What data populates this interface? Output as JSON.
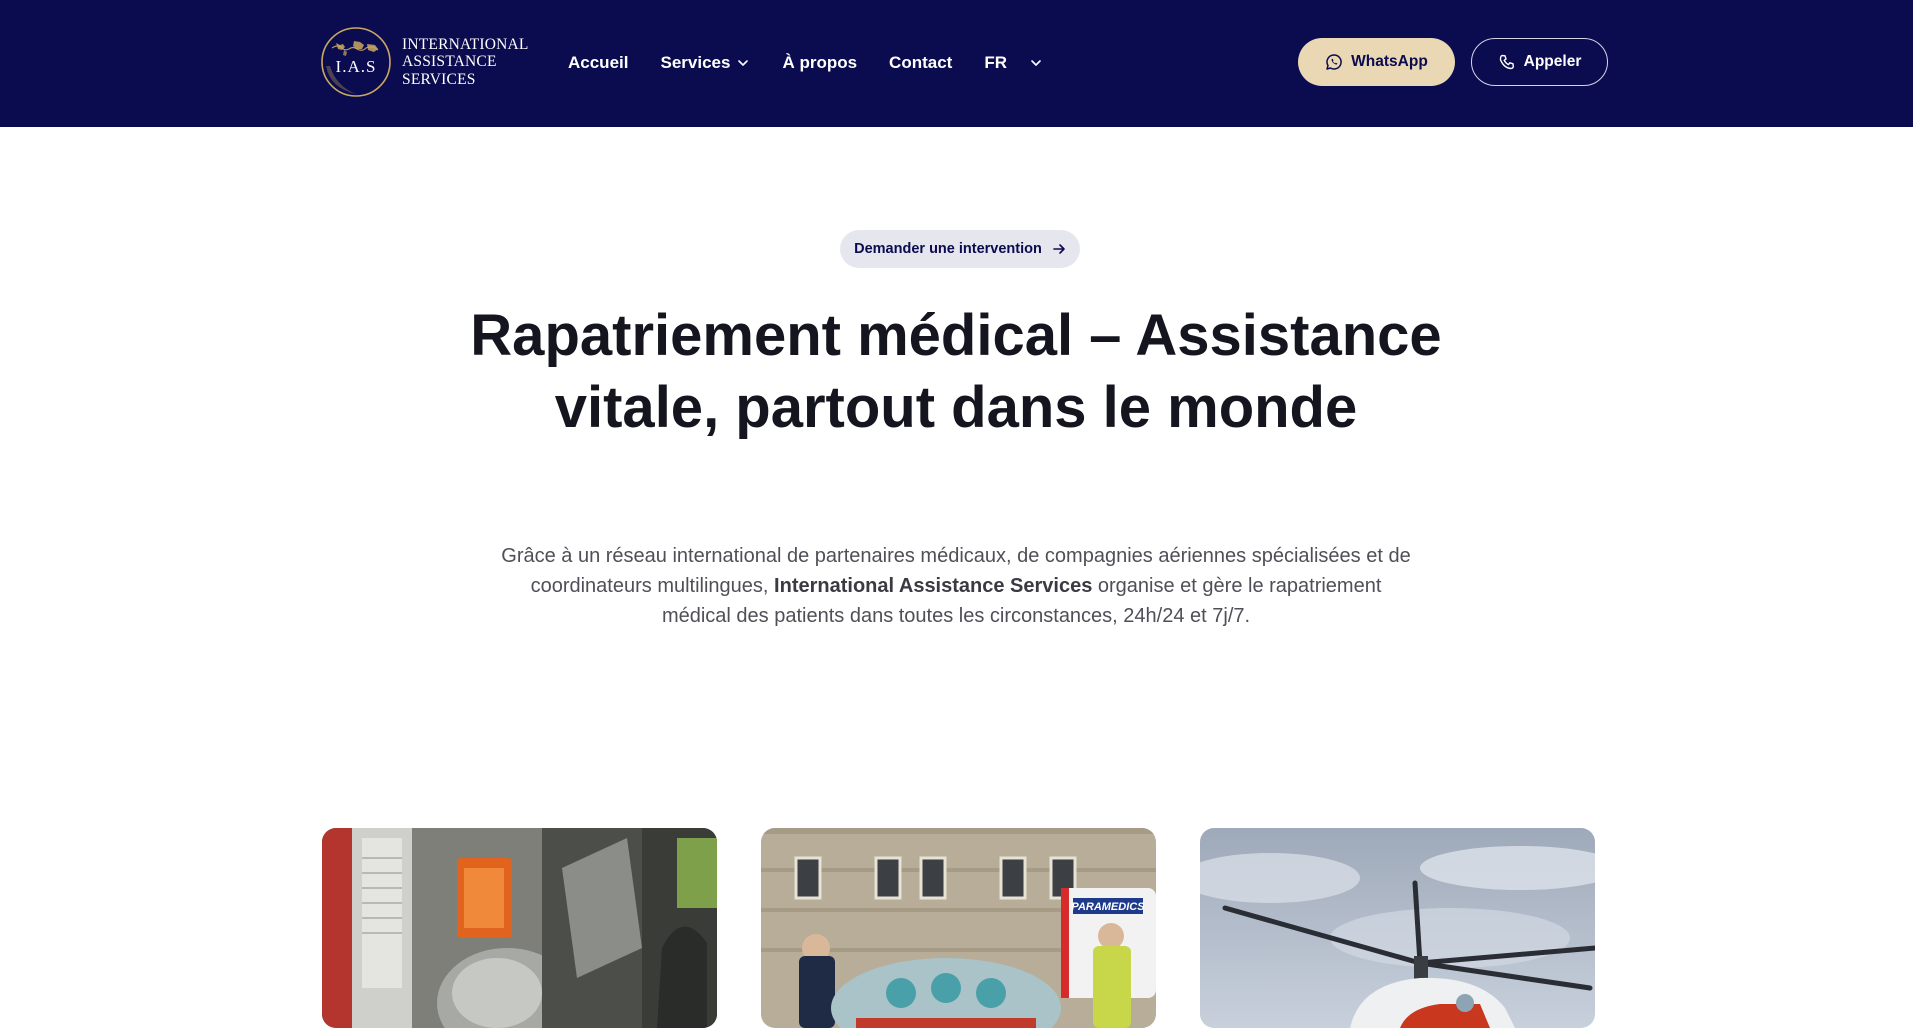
{
  "header": {
    "logo": {
      "monogram": "I.A.S",
      "lines": [
        "INTERNATIONAL",
        "ASSISTANCE",
        "SERVICES"
      ]
    },
    "nav": [
      {
        "label": "Accueil",
        "has_dropdown": false
      },
      {
        "label": "Services",
        "has_dropdown": true
      },
      {
        "label": "À propos",
        "has_dropdown": false
      },
      {
        "label": "Contact",
        "has_dropdown": false
      }
    ],
    "language": {
      "selected": "FR"
    },
    "whatsapp_label": "WhatsApp",
    "call_label": "Appeler"
  },
  "hero": {
    "badge_label": "Demander une intervention",
    "title": "Rapatriement médical – Assistance vitale, partout dans le monde",
    "description_before": "Grâce à un réseau international de partenaires médicaux, de compagnies aériennes spécialisées et de coordinateurs multilingues, ",
    "description_bold": "International Assistance Services",
    "description_after": " organise et gère le rapatriement médical des patients dans toutes les circonstances, 24h/24 et 7j/7."
  },
  "cards": [
    {
      "image": "ambulance-interior-photo"
    },
    {
      "image": "paramedics-stretcher-photo"
    },
    {
      "image": "medical-helicopter-photo"
    }
  ],
  "colors": {
    "header_bg": "#0b0b4f",
    "accent_gold": "#ead8b4",
    "pill_bg": "#e6e6ee",
    "text_dark": "#15151f",
    "text_muted": "#4f4f57"
  },
  "icons": {
    "whatsapp": "whatsapp-icon",
    "call": "phone-icon",
    "badge": "arrow-right-icon",
    "dropdown": "chevron-down-icon"
  }
}
